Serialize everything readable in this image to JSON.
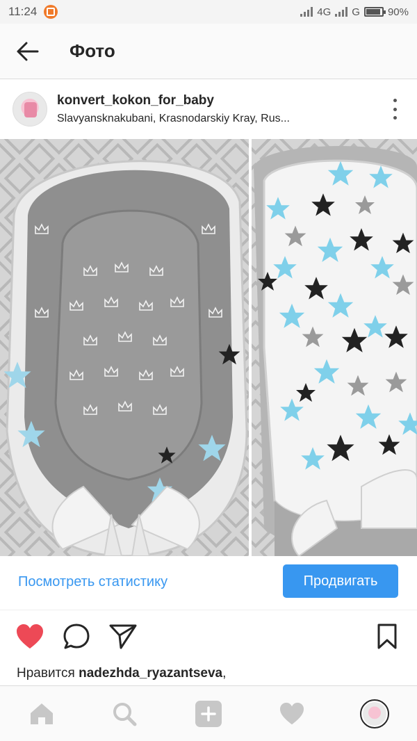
{
  "status_bar": {
    "time": "11:24",
    "network": "4G",
    "network2": "G",
    "battery": "90%",
    "battery_level": 0.9
  },
  "header": {
    "title": "Фото"
  },
  "post": {
    "username": "konvert_kokon_for_baby",
    "location": "Slavyansknakubani, Krasnodarskiy Kray, Rus..."
  },
  "promote": {
    "stats_link": "Посмотреть статистику",
    "promote_button": "Продвигать"
  },
  "likes": {
    "prefix": "Нравится ",
    "user": "nadezhda_ryazantseva",
    "suffix": ","
  },
  "icons": {
    "back": "arrow-left-icon",
    "more": "more-vertical-icon",
    "like": "heart-filled-icon",
    "comment": "comment-icon",
    "share": "send-icon",
    "save": "bookmark-icon",
    "nav": [
      "home-icon",
      "search-icon",
      "add-icon",
      "heart-icon",
      "profile-avatar"
    ]
  },
  "colors": {
    "accent": "#3897f0",
    "like": "#ed4956",
    "nav_inactive": "#c7c7c7"
  }
}
